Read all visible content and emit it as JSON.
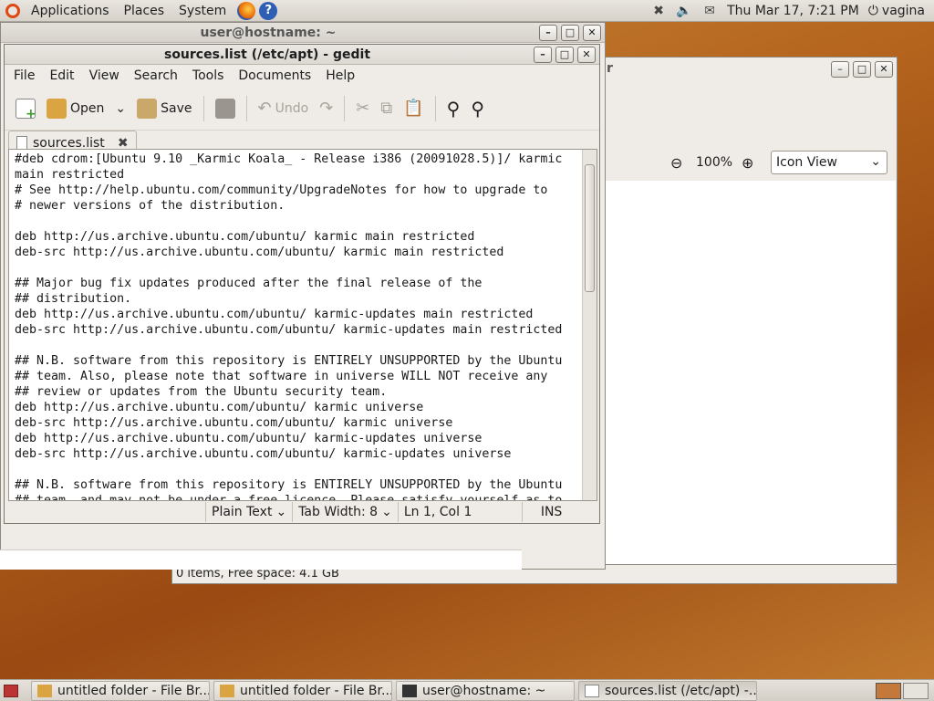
{
  "top_panel": {
    "menus": [
      "Applications",
      "Places",
      "System"
    ],
    "clock": "Thu Mar 17,  7:21 PM",
    "user": "vagina"
  },
  "terminal": {
    "title": "user@hostname: ~"
  },
  "file_browser": {
    "title_fragment": "r",
    "zoom": "100%",
    "view_mode": "Icon View",
    "status": "0 items, Free space: 4.1 GB"
  },
  "gedit": {
    "title": "sources.list (/etc/apt) - gedit",
    "menu": [
      "File",
      "Edit",
      "View",
      "Search",
      "Tools",
      "Documents",
      "Help"
    ],
    "toolbar": {
      "open": "Open",
      "save": "Save",
      "undo": "Undo"
    },
    "tab": "sources.list",
    "content": "#deb cdrom:[Ubuntu 9.10 _Karmic Koala_ - Release i386 (20091028.5)]/ karmic\nmain restricted\n# See http://help.ubuntu.com/community/UpgradeNotes for how to upgrade to\n# newer versions of the distribution.\n\ndeb http://us.archive.ubuntu.com/ubuntu/ karmic main restricted\ndeb-src http://us.archive.ubuntu.com/ubuntu/ karmic main restricted\n\n## Major bug fix updates produced after the final release of the\n## distribution.\ndeb http://us.archive.ubuntu.com/ubuntu/ karmic-updates main restricted\ndeb-src http://us.archive.ubuntu.com/ubuntu/ karmic-updates main restricted\n\n## N.B. software from this repository is ENTIRELY UNSUPPORTED by the Ubuntu\n## team. Also, please note that software in universe WILL NOT receive any\n## review or updates from the Ubuntu security team.\ndeb http://us.archive.ubuntu.com/ubuntu/ karmic universe\ndeb-src http://us.archive.ubuntu.com/ubuntu/ karmic universe\ndeb http://us.archive.ubuntu.com/ubuntu/ karmic-updates universe\ndeb-src http://us.archive.ubuntu.com/ubuntu/ karmic-updates universe\n\n## N.B. software from this repository is ENTIRELY UNSUPPORTED by the Ubuntu\n## team, and may not be under a free licence. Please satisfy yourself as to",
    "status": {
      "language": "Plain Text",
      "tab_width": "Tab Width:  8",
      "position": "Ln 1, Col 1",
      "mode": "INS"
    }
  },
  "taskbar": [
    {
      "label": "untitled folder - File Br...",
      "icon": "folder-icon"
    },
    {
      "label": "untitled folder - File Br...",
      "icon": "folder-icon"
    },
    {
      "label": "user@hostname: ~",
      "icon": "terminal-icon"
    },
    {
      "label": "sources.list (/etc/apt) -...",
      "icon": "text-editor-icon"
    }
  ]
}
